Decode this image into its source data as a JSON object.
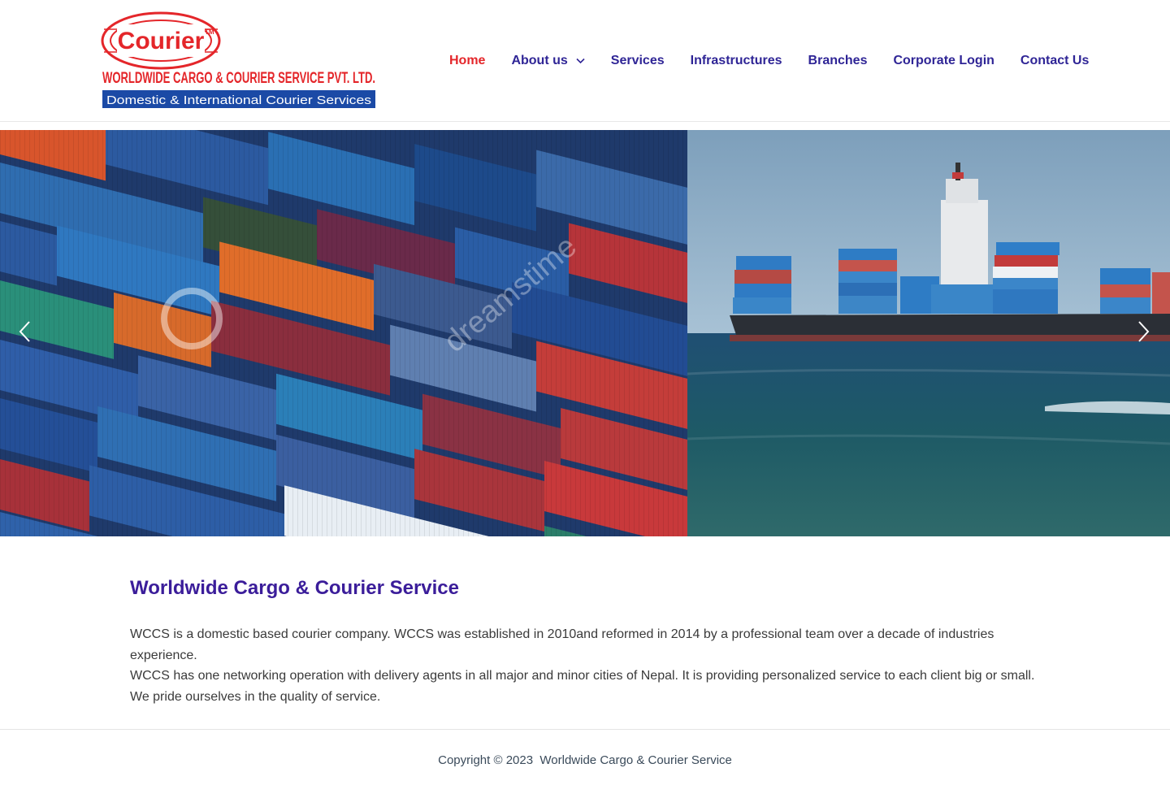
{
  "logo": {
    "brand": "Courier",
    "tm": "TM",
    "company": "WORLDWIDE CARGO & COURIER SERVICE PVT. LTD.",
    "tagline": "Domestic & International Courier Services"
  },
  "nav": {
    "items": [
      {
        "label": "Home"
      },
      {
        "label": "About us"
      },
      {
        "label": "Services"
      },
      {
        "label": "Infrastructures"
      },
      {
        "label": "Branches"
      },
      {
        "label": "Corporate Login"
      },
      {
        "label": "Contact Us"
      }
    ]
  },
  "slider": {
    "icons": {
      "prev": "chevron-left-icon",
      "next": "chevron-right-icon"
    },
    "watermark": "dreamstime"
  },
  "main": {
    "title": "Worldwide Cargo & Courier Service",
    "paragraph1": "WCCS is a domestic based courier company. WCCS was established in 2010and reformed in 2014 by a professional team over a decade of industries experience.",
    "paragraph2": "WCCS has one networking operation with delivery agents in all major and minor cities of Nepal. It is providing personalized service to each client big or small. We pride ourselves in the quality of service."
  },
  "footer": {
    "copyright": "Copyright © 2023  Worldwide Cargo & Courier Service"
  },
  "colors": {
    "nav": "#2f2596",
    "active": "#e4262a",
    "title": "#3b1d9a",
    "logo_red": "#e4262a",
    "logo_blue": "#1b4aa6"
  }
}
